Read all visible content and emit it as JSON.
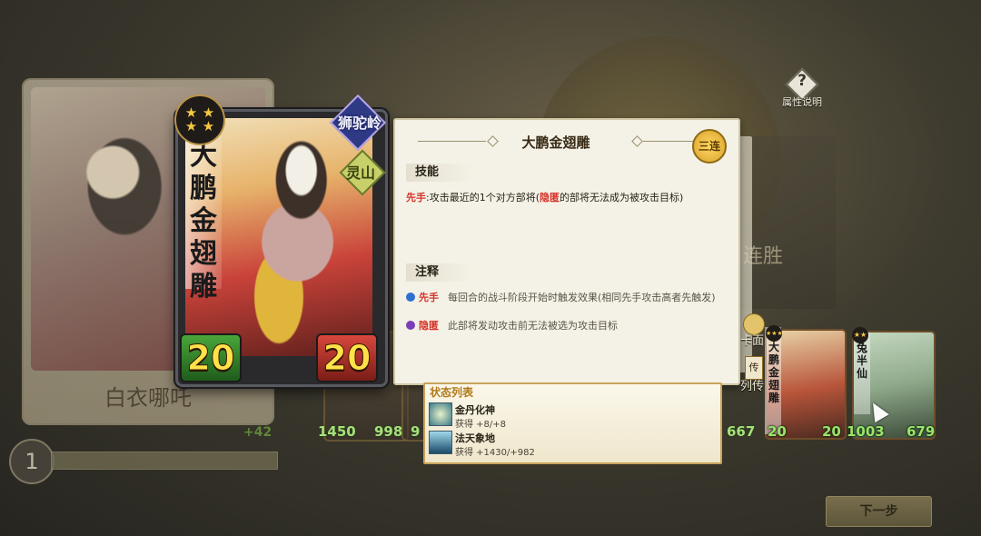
{
  "help": {
    "label": "属性说明",
    "symbol": "?"
  },
  "background_text": "连胜",
  "left_card": {
    "name": "白衣哪吒"
  },
  "level": {
    "value": "1",
    "gain": "+42"
  },
  "main_card": {
    "name": "大鹏金翅雕",
    "stars": 4,
    "faction": "狮驼岭",
    "sub_faction": "灵山",
    "attack": "20",
    "health": "20"
  },
  "bottom_row": [
    {
      "left": "1450",
      "right": "998"
    },
    {
      "left": "9",
      "right": ""
    }
  ],
  "info_panel": {
    "title": "大鹏金翅雕",
    "rarity_badge": "三连",
    "skill_header": "技能",
    "skill": {
      "keyword": "先手",
      "text_a": ":攻击最近的1个对方部将(",
      "keyword2": "隐匿",
      "text_b": "的部将无法成为被攻击目标)"
    },
    "notes_header": "注释",
    "notes": [
      {
        "keyword": "先手",
        "text": "每回合的战斗阶段开始时触发效果(相同先手攻击高者先触发)",
        "icon_color": "#2e6fd0"
      },
      {
        "keyword": "隐匿",
        "text": "此部将发动攻击前无法被选为攻击目标",
        "icon_color": "#7a3fb8"
      }
    ]
  },
  "status_list": {
    "title": "状态列表",
    "items": [
      {
        "name": "金丹化神",
        "gain": "获得 +8/+8"
      },
      {
        "name": "法天象地",
        "gain": "获得 +1430/+982"
      }
    ]
  },
  "side_tabs": {
    "card_face": "卡面",
    "biography": "列传",
    "bio_seal": "传"
  },
  "right_cards": [
    {
      "name": "大鹏金翅雕",
      "left": "20",
      "right": "20",
      "stars": 3
    },
    {
      "name": "兔半仙",
      "left": "1003",
      "right": "679",
      "stars": 2
    }
  ],
  "partial_num": "667",
  "next_button": "下一步"
}
